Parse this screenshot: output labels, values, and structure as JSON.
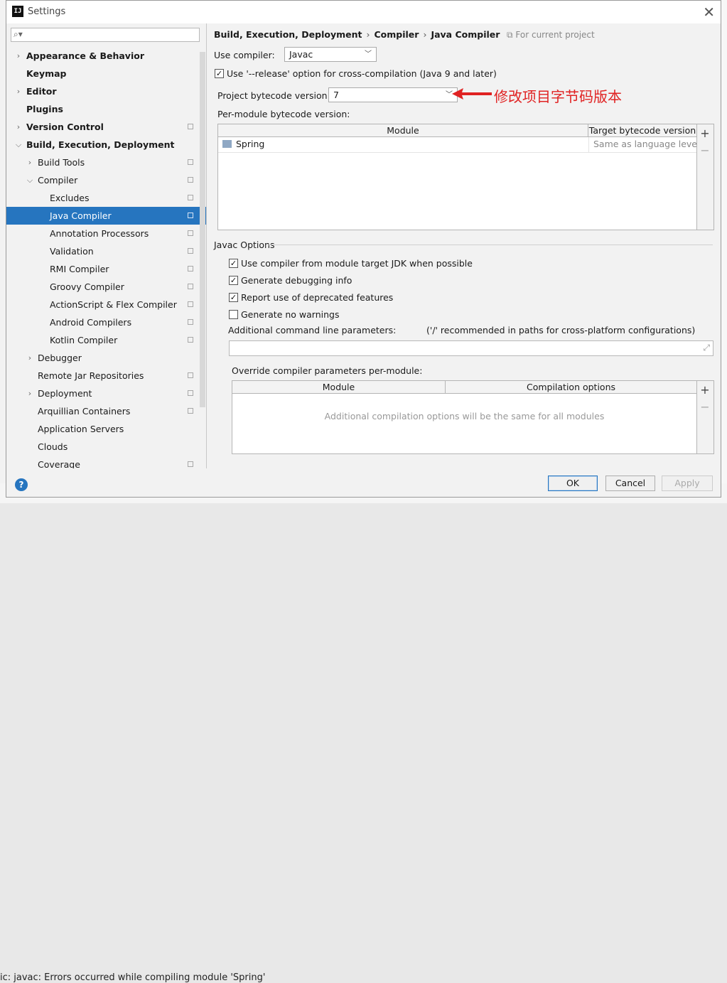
{
  "background": {
    "status_text": "ic: javac: Errors occurred while compiling module 'Spring'"
  },
  "window": {
    "title": "Settings",
    "app_icon": "IJ"
  },
  "search": {
    "placeholder": ""
  },
  "sidebar": {
    "items": [
      {
        "label": "Appearance & Behavior",
        "level": 0,
        "expander": "collapsed",
        "bold": true,
        "project_icon": false
      },
      {
        "label": "Keymap",
        "level": 0,
        "expander": "none",
        "bold": true,
        "project_icon": false
      },
      {
        "label": "Editor",
        "level": 0,
        "expander": "collapsed",
        "bold": true,
        "project_icon": false
      },
      {
        "label": "Plugins",
        "level": 0,
        "expander": "none",
        "bold": true,
        "project_icon": false
      },
      {
        "label": "Version Control",
        "level": 0,
        "expander": "collapsed",
        "bold": true,
        "project_icon": true
      },
      {
        "label": "Build, Execution, Deployment",
        "level": 0,
        "expander": "expanded",
        "bold": true,
        "project_icon": false
      },
      {
        "label": "Build Tools",
        "level": 1,
        "expander": "collapsed",
        "bold": false,
        "project_icon": true
      },
      {
        "label": "Compiler",
        "level": 1,
        "expander": "expanded",
        "bold": false,
        "project_icon": true
      },
      {
        "label": "Excludes",
        "level": 2,
        "expander": "none",
        "bold": false,
        "project_icon": true
      },
      {
        "label": "Java Compiler",
        "level": 2,
        "expander": "none",
        "bold": false,
        "project_icon": true,
        "selected": true
      },
      {
        "label": "Annotation Processors",
        "level": 2,
        "expander": "none",
        "bold": false,
        "project_icon": true
      },
      {
        "label": "Validation",
        "level": 2,
        "expander": "none",
        "bold": false,
        "project_icon": true
      },
      {
        "label": "RMI Compiler",
        "level": 2,
        "expander": "none",
        "bold": false,
        "project_icon": true
      },
      {
        "label": "Groovy Compiler",
        "level": 2,
        "expander": "none",
        "bold": false,
        "project_icon": true
      },
      {
        "label": "ActionScript & Flex Compiler",
        "level": 2,
        "expander": "none",
        "bold": false,
        "project_icon": true
      },
      {
        "label": "Android Compilers",
        "level": 2,
        "expander": "none",
        "bold": false,
        "project_icon": true
      },
      {
        "label": "Kotlin Compiler",
        "level": 2,
        "expander": "none",
        "bold": false,
        "project_icon": true
      },
      {
        "label": "Debugger",
        "level": 1,
        "expander": "collapsed",
        "bold": false,
        "project_icon": false
      },
      {
        "label": "Remote Jar Repositories",
        "level": 1,
        "expander": "none",
        "bold": false,
        "project_icon": true
      },
      {
        "label": "Deployment",
        "level": 1,
        "expander": "collapsed",
        "bold": false,
        "project_icon": true
      },
      {
        "label": "Arquillian Containers",
        "level": 1,
        "expander": "none",
        "bold": false,
        "project_icon": true
      },
      {
        "label": "Application Servers",
        "level": 1,
        "expander": "none",
        "bold": false,
        "project_icon": false
      },
      {
        "label": "Clouds",
        "level": 1,
        "expander": "none",
        "bold": false,
        "project_icon": false
      },
      {
        "label": "Coverage",
        "level": 1,
        "expander": "none",
        "bold": false,
        "project_icon": true
      }
    ]
  },
  "breadcrumb": {
    "parts": [
      "Build, Execution, Deployment",
      "Compiler",
      "Java Compiler"
    ],
    "separator": "›",
    "scope": "For current project"
  },
  "compiler": {
    "use_compiler_label": "Use compiler:",
    "use_compiler_value": "Javac",
    "release_option_label": "Use '--release' option for cross-compilation (Java 9 and later)",
    "release_option_checked": true,
    "bytecode_label": "Project bytecode version:",
    "bytecode_value": "7",
    "per_module_label": "Per-module bytecode version:",
    "module_table": {
      "columns": [
        "Module",
        "Target bytecode version"
      ],
      "rows": [
        {
          "module": "Spring",
          "target": "Same as language level"
        }
      ]
    }
  },
  "javac_options": {
    "section_title": "Javac Options",
    "checkboxes": [
      {
        "label": "Use compiler from module target JDK when possible",
        "checked": true
      },
      {
        "label": "Generate debugging info",
        "checked": true
      },
      {
        "label": "Report use of deprecated features",
        "checked": true
      },
      {
        "label": "Generate no warnings",
        "checked": false
      }
    ],
    "additional_params_label": "Additional command line parameters:",
    "additional_params_hint": "('/' recommended in paths for cross-platform configurations)",
    "additional_params_value": "",
    "override_label": "Override compiler parameters per-module:",
    "override_table": {
      "columns": [
        "Module",
        "Compilation options"
      ],
      "empty_text": "Additional compilation options will be the same for all modules"
    }
  },
  "side_buttons": {
    "add": "+",
    "remove": "−"
  },
  "annotation": {
    "text": "修改项目字节码版本",
    "color": "#e02222"
  },
  "buttons": {
    "help": "?",
    "ok": "OK",
    "cancel": "Cancel",
    "apply": "Apply"
  },
  "colors": {
    "selection": "#2675bf",
    "accent": "#2675bf"
  }
}
